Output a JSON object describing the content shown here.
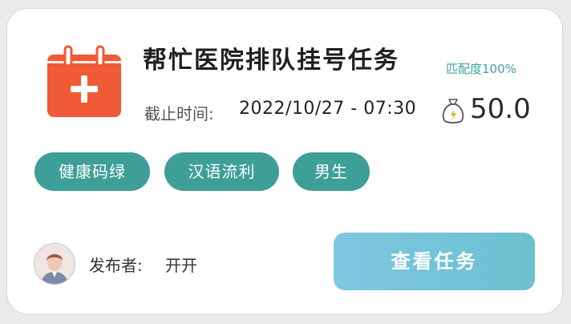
{
  "task": {
    "title": "帮忙医院排队挂号任务",
    "match_text": "匹配度100%",
    "deadline_label": "截止时间:",
    "deadline_value": "2022/10/27 - 07:30",
    "reward": "50.0",
    "tags": [
      "健康码绿",
      "汉语流利",
      "男生"
    ],
    "publisher_label": "发布者:",
    "publisher_name": "开开",
    "view_button_label": "查看任务"
  },
  "icons": {
    "calendar": "calendar-plus-icon",
    "reward": "money-bag-icon",
    "avatar": "user-avatar"
  },
  "colors": {
    "calendar_red": "#f05a36",
    "tag_teal": "#3e9e98",
    "match_teal": "#3fa39b",
    "button_start": "#7ec7e1",
    "button_end": "#6cc0cf"
  }
}
